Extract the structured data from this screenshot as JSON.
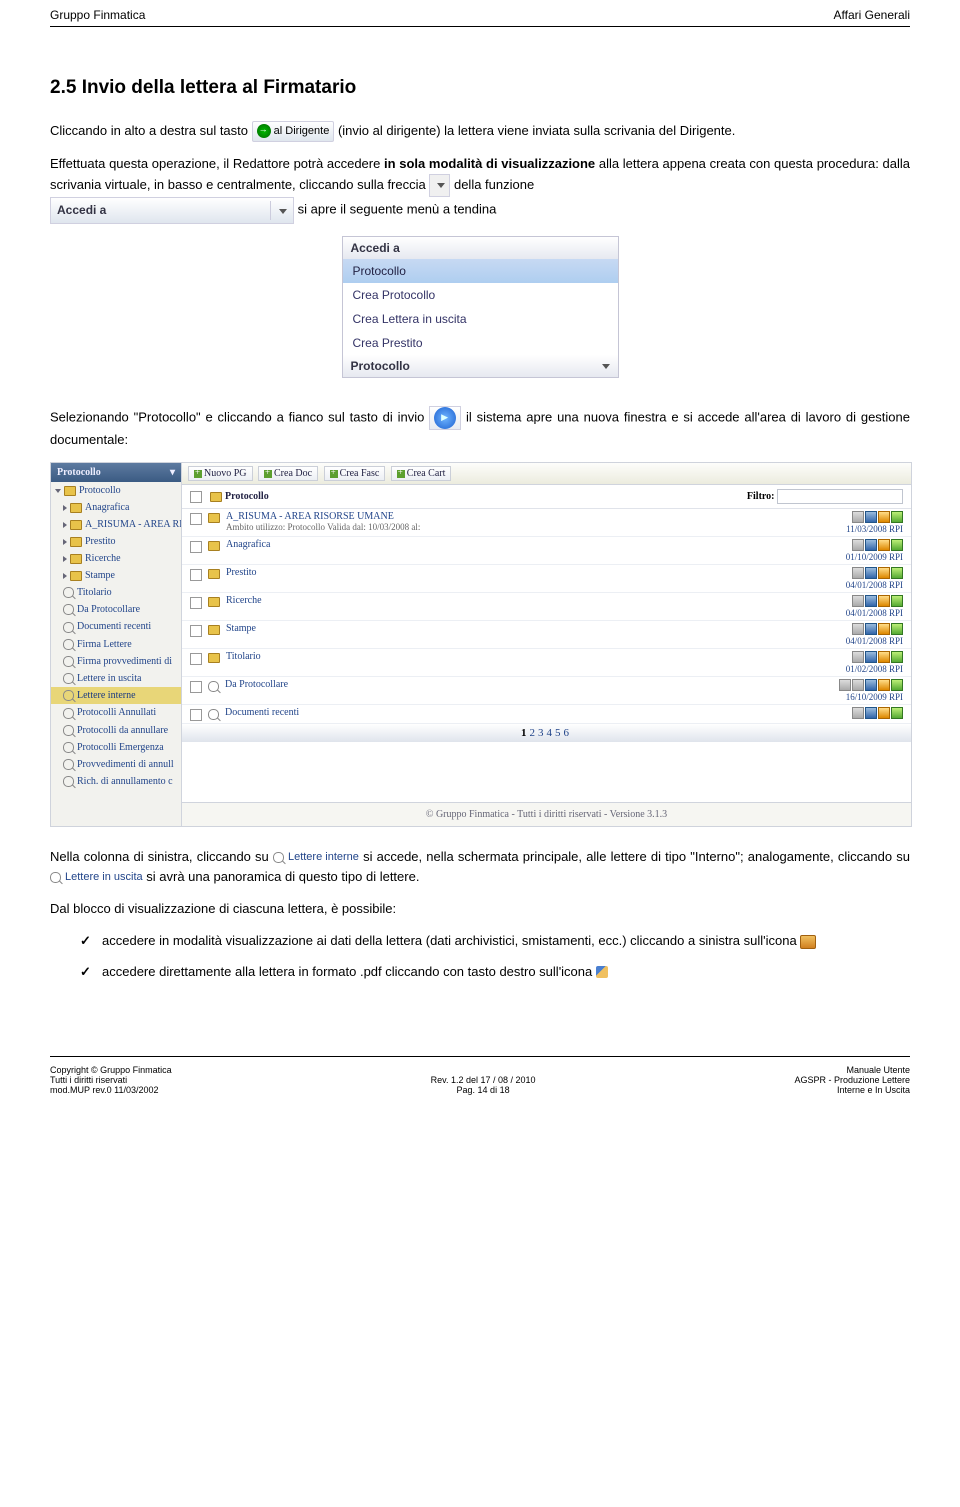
{
  "header": {
    "left": "Gruppo Finmatica",
    "right": "Affari Generali"
  },
  "title": "2.5 Invio della lettera al Firmatario",
  "p1a": "Cliccando in alto a destra sul tasto ",
  "btn_dirigente": "al Dirigente",
  "p1b": " (invio al dirigente) la lettera viene inviata sulla scrivania del Dirigente.",
  "p2_pre": "Effettuata questa operazione, il Redattore potrà accedere ",
  "p2_bold1": "in sola modalità di visualizzazione",
  "p2_mid1": " alla lettera appena creata con questa procedura: dalla scrivania virtuale, in basso e centralmente, cliccando sulla freccia ",
  "p2_mid2": " della funzione ",
  "accedi_label": "Accedi a",
  "p2_end": " si apre il seguente menù a tendina",
  "menu": {
    "head": "Accedi a",
    "items": [
      "Protocollo",
      "Crea Protocollo",
      "Crea Lettera in uscita",
      "Crea Prestito"
    ],
    "selected": 0,
    "foot": "Protocollo"
  },
  "p3a": "Selezionando \"Protocollo\" e cliccando a fianco sul tasto di invio ",
  "p3b": " il sistema apre una nuova finestra e si accede all'area di lavoro di gestione documentale:",
  "app": {
    "side_drop": "Protocollo",
    "side_root": "Protocollo",
    "side_folders": [
      "Anagrafica",
      "A_RISUMA - AREA RISO",
      "Prestito",
      "Ricerche",
      "Stampe"
    ],
    "side_tree": [
      "Titolario",
      "Da Protocollare",
      "Documenti recenti",
      "Firma Lettere",
      "Firma provvedimenti di",
      "Lettere in uscita",
      "Lettere interne",
      "Protocolli Annullati",
      "Protocolli da annullare",
      "Protocolli Emergenza",
      "Provvedimenti di annull",
      "Rich. di annullamento c"
    ],
    "toolbar": [
      "Nuovo PG",
      "Crea Doc",
      "Crea Fasc",
      "Crea Cart"
    ],
    "proto_label": "Protocollo",
    "filtro_label": "Filtro:",
    "rows": [
      {
        "name": "A_RISUMA - AREA RISORSE UMANE",
        "sub": "Ambito utilizzo: Protocollo Valida dal: 10/03/2008 al:",
        "date": "11/03/2008 RPI",
        "icons": "ibpg",
        "srch": false
      },
      {
        "name": "Anagrafica",
        "sub": "",
        "date": "01/10/2009 RPI",
        "icons": "bog",
        "srch": false
      },
      {
        "name": "Prestito",
        "sub": "",
        "date": "04/01/2008 RPI",
        "icons": "bog",
        "srch": false
      },
      {
        "name": "Ricerche",
        "sub": "",
        "date": "04/01/2008 RPI",
        "icons": "bog",
        "srch": false
      },
      {
        "name": "Stampe",
        "sub": "",
        "date": "04/01/2008 RPI",
        "icons": "bog",
        "srch": false
      },
      {
        "name": "Titolario",
        "sub": "",
        "date": "01/02/2008 RPI",
        "icons": "bog",
        "srch": false
      },
      {
        "name": "Da Protocollare",
        "sub": "",
        "date": "16/10/2009 RPI",
        "icons": "gbpog",
        "srch": true
      },
      {
        "name": "Documenti recenti",
        "sub": "",
        "date": "",
        "icons": "pbg",
        "srch": true
      }
    ],
    "pager": [
      "1",
      "2",
      "3",
      "4",
      "5",
      "6"
    ],
    "footer": "© Gruppo Finmatica - Tutti i diritti riservati - Versione 3.1.3"
  },
  "p4a": "Nella colonna di sinistra, cliccando su ",
  "chip_interne": "Lettere interne",
  "p4b": " si accede, nella schermata principale, alle lettere di tipo \"Interno\"; analogamente, cliccando su ",
  "chip_uscita": "Lettere in uscita",
  "p4c": " si avrà una panoramica di questo tipo di lettere.",
  "p5": "Dal blocco di visualizzazione di ciascuna lettera, è possibile:",
  "li1a": "accedere in modalità visualizzazione ai dati della lettera (dati archivistici, smistamenti, ecc.) cliccando a sinistra sull'icona ",
  "li2a": "accedere direttamente alla lettera in formato .pdf cliccando con tasto destro sull'icona ",
  "footer": {
    "l1": "Copyright © Gruppo Finmatica",
    "l2": "Tutti i diritti riservati",
    "l3": "mod.MUP rev.0  11/03/2002",
    "c1": "Rev. 1.2  del 17 / 08 / 2010",
    "c2": "Pag. 14 di 18",
    "r1": "Manuale Utente",
    "r2": "AGSPR - Produzione Lettere",
    "r3": "Interne e In Uscita"
  }
}
